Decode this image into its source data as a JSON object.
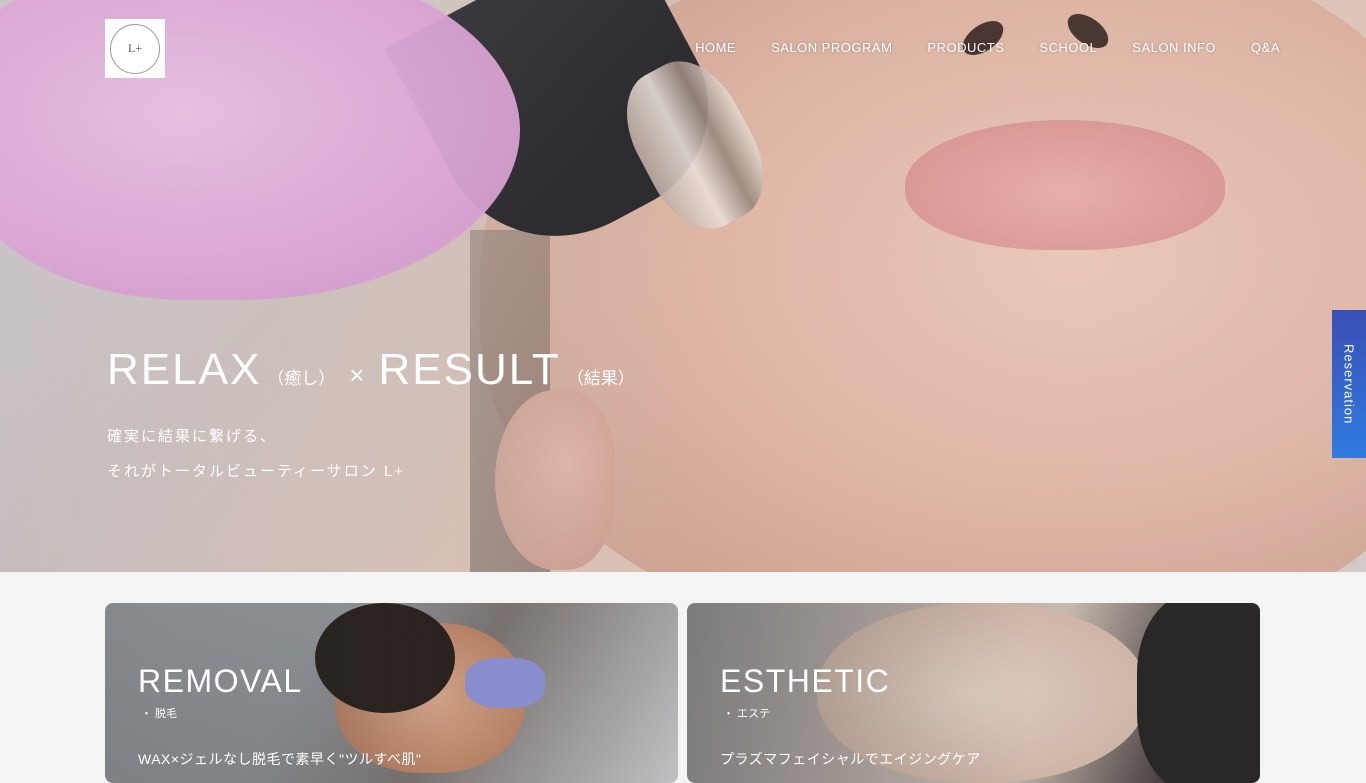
{
  "header": {
    "logo_text": "L+",
    "nav": [
      {
        "label": "HOME"
      },
      {
        "label": "SALON PROGRAM"
      },
      {
        "label": "PRODUCTS"
      },
      {
        "label": "SCHOOL"
      },
      {
        "label": "SALON INFO"
      },
      {
        "label": "Q&A"
      }
    ]
  },
  "hero": {
    "title_part1": "RELAX",
    "title_part1_sub": "（癒し）",
    "title_times": "×",
    "title_part2": "RESULT",
    "title_part2_sub": "（結果）",
    "subtitle_line1": "確実に結果に繋げる、",
    "subtitle_line2": "それがトータルビューティーサロン L+"
  },
  "reservation": {
    "label": "Reservation"
  },
  "cards": [
    {
      "title": "REMOVAL",
      "sub": "・ 脱毛",
      "desc": "WAX×ジェルなし脱毛で素早く\"ツルすべ肌\""
    },
    {
      "title": "ESTHETIC",
      "sub": "・ エステ",
      "desc": "プラズマフェイシャルでエイジングケア"
    }
  ],
  "colors": {
    "reservation_top": "#3a4fb5",
    "reservation_bottom": "#2f7be0",
    "text_light": "#ffffff"
  }
}
